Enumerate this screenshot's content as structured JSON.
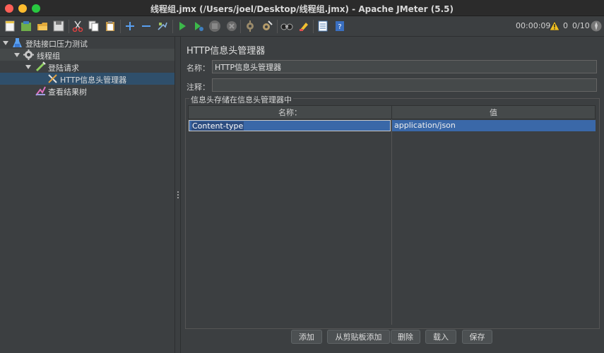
{
  "window": {
    "title": "线程组.jmx (/Users/joel/Desktop/线程组.jmx) - Apache JMeter (5.5)"
  },
  "toolbar": {
    "timer": "00:00:09",
    "warnings": "0",
    "threads": "0/10",
    "icons": [
      "new-icon",
      "templates-icon",
      "open-icon",
      "save-icon",
      "cut-icon",
      "copy-icon",
      "paste-icon",
      "expand-icon",
      "collapse-icon",
      "toggle-icon",
      "start-icon",
      "start-no-pause-icon",
      "stop-icon",
      "shutdown-icon",
      "clear-icon",
      "clear-all-icon",
      "search-icon",
      "reset-search-icon",
      "function-helper-icon",
      "help-icon"
    ]
  },
  "tree": {
    "items": [
      {
        "label": "登陆接口压力测试",
        "icon": "test-plan-icon",
        "level": 0,
        "expanded": true
      },
      {
        "label": "线程组",
        "icon": "thread-group-icon",
        "level": 1,
        "expanded": true
      },
      {
        "label": "登陆请求",
        "icon": "sampler-icon",
        "level": 2,
        "expanded": true
      },
      {
        "label": "HTTP信息头管理器",
        "icon": "config-icon",
        "level": 3,
        "selected": true
      },
      {
        "label": "查看结果树",
        "icon": "listener-icon",
        "level": 2
      }
    ]
  },
  "panel": {
    "title": "HTTP信息头管理器",
    "name_label": "名称：",
    "name_value": "HTTP信息头管理器",
    "comment_label": "注释：",
    "comment_value": "",
    "group_title": "信息头存储在信息头管理器中",
    "table": {
      "columns": [
        "名称：",
        "值"
      ],
      "rows": [
        {
          "name": "Content-type",
          "value": "application/json"
        }
      ]
    },
    "buttons": [
      "添加",
      "从剪贴板添加",
      "删除",
      "载入",
      "保存"
    ]
  },
  "colors": {
    "accent": "#3a68a8",
    "background": "#3c3f41",
    "selection": "#2f4f6b"
  }
}
